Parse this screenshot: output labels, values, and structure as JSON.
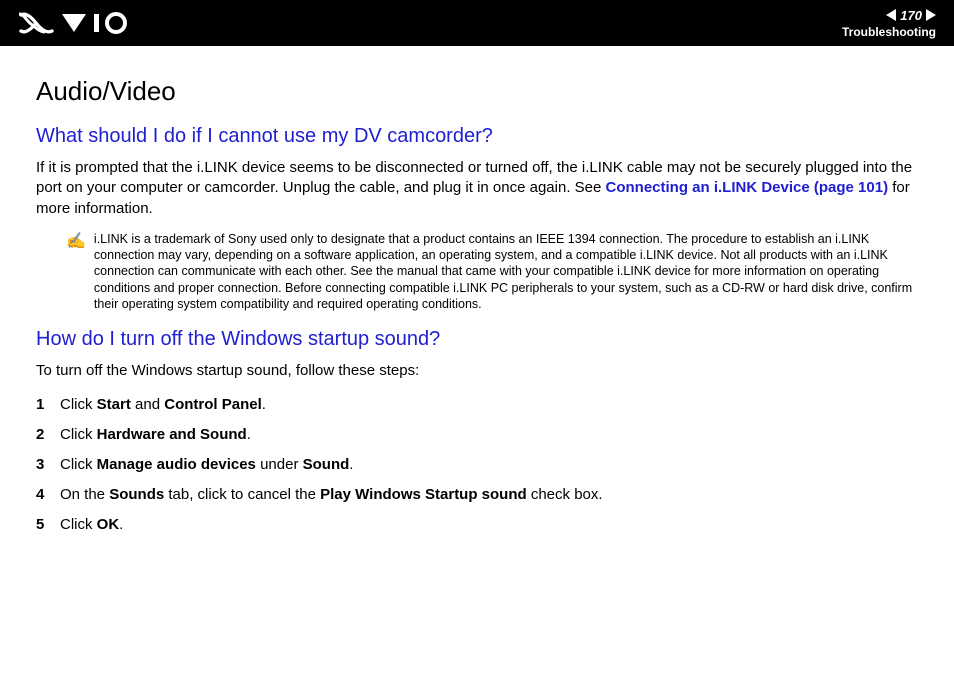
{
  "header": {
    "page_number": "170",
    "section": "Troubleshooting"
  },
  "content": {
    "title": "Audio/Video",
    "q1": {
      "heading": "What should I do if I cannot use my DV camcorder?",
      "para_a": "If it is prompted that the i.LINK device seems to be disconnected or turned off, the i.LINK cable may not be securely plugged into the port on your computer or camcorder. Unplug the cable, and plug it in once again. See ",
      "link": "Connecting an i.LINK Device (page 101)",
      "para_b": " for more information.",
      "note_icon": "✍",
      "note": "i.LINK is a trademark of Sony used only to designate that a product contains an IEEE 1394 connection. The procedure to establish an i.LINK connection may vary, depending on a software application, an operating system, and a compatible i.LINK device. Not all products with an i.LINK connection can communicate with each other. See the manual that came with your compatible i.LINK device for more information on operating conditions and proper connection. Before connecting compatible i.LINK PC peripherals to your system, such as a CD-RW or hard disk drive, confirm their operating system compatibility and required operating conditions."
    },
    "q2": {
      "heading": "How do I turn off the Windows startup sound?",
      "intro": "To turn off the Windows startup sound, follow these steps:",
      "steps": [
        {
          "pre": "Click ",
          "b1": "Start",
          "mid": " and ",
          "b2": "Control Panel",
          "post": "."
        },
        {
          "pre": "Click ",
          "b1": "Hardware and Sound",
          "post": "."
        },
        {
          "pre": "Click ",
          "b1": "Manage audio devices",
          "mid": " under ",
          "b2": "Sound",
          "post": "."
        },
        {
          "pre": "On the ",
          "b1": "Sounds",
          "mid": " tab, click to cancel the ",
          "b2": "Play Windows Startup sound",
          "post": " check box."
        },
        {
          "pre": "Click ",
          "b1": "OK",
          "post": "."
        }
      ]
    }
  }
}
